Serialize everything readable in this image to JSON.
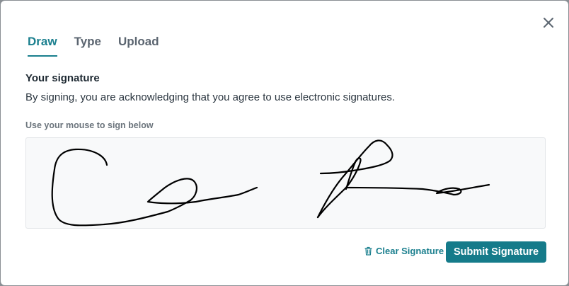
{
  "modal": {
    "close_icon": "close-icon",
    "tabs": [
      {
        "label": "Draw",
        "active": true
      },
      {
        "label": "Type",
        "active": false
      },
      {
        "label": "Upload",
        "active": false
      }
    ],
    "section_title": "Your signature",
    "section_description": "By signing, you are acknowledging that you agree to use electronic signatures.",
    "pad_hint": "Use your mouse to sign below",
    "clear_label": "Clear Signature",
    "clear_icon": "trash-icon",
    "submit_label": "Submit Signature",
    "colors": {
      "accent": "#157b8a",
      "accent_text": "#1a7f8e",
      "pad_background": "#f8f9fa",
      "ink": "#000000"
    }
  }
}
